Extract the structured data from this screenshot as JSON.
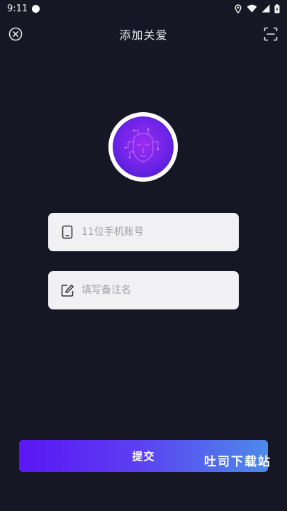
{
  "status_bar": {
    "time": "9:11"
  },
  "header": {
    "title": "添加关爱"
  },
  "form": {
    "phone_placeholder": "11位手机账号",
    "remark_placeholder": "填写备注名"
  },
  "submit": {
    "label": "提交"
  },
  "watermark": {
    "text": "吐司下载站"
  },
  "colors": {
    "background": "#171624",
    "field_background": "#f1f1f3",
    "button_gradient_start": "#5a16f5",
    "button_gradient_end": "#4d8be9",
    "avatar_purple": "#7a25ea"
  },
  "icons": [
    "close-icon",
    "scan-icon",
    "phone-icon",
    "edit-icon",
    "location-icon",
    "wifi-icon",
    "signal-icon",
    "battery-icon"
  ]
}
